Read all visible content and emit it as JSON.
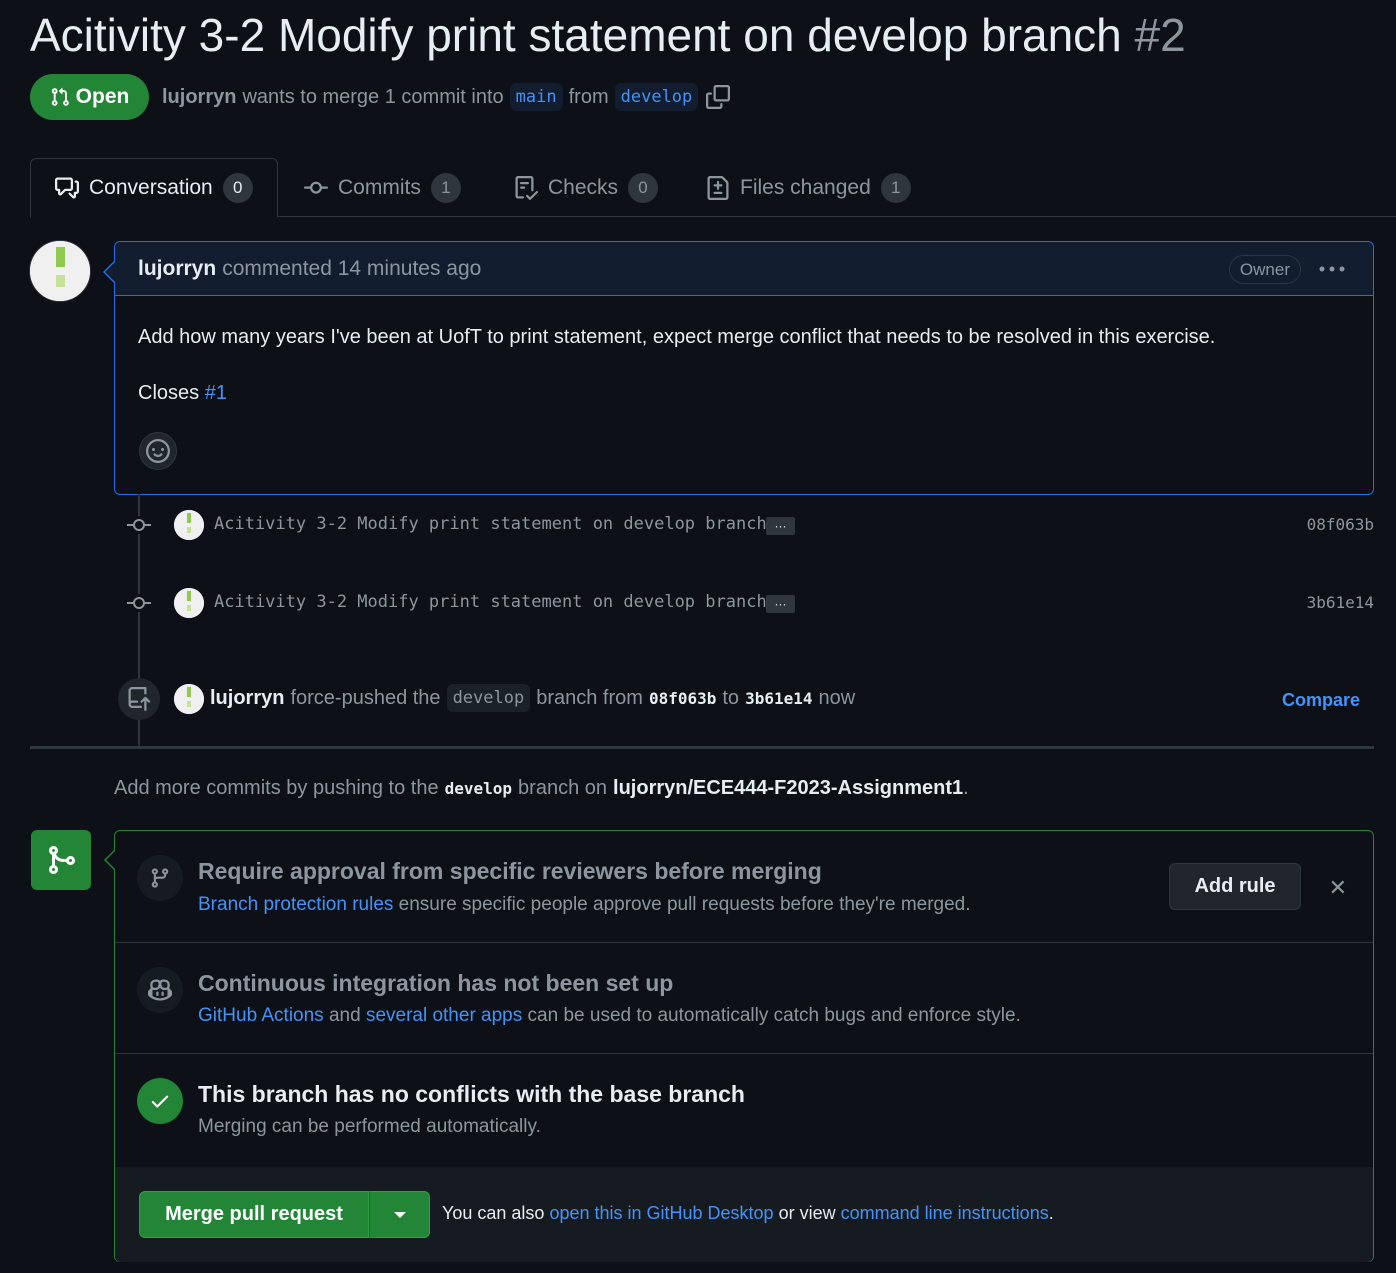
{
  "pr": {
    "title": "Acitivity 3-2 Modify print statement on develop branch",
    "number": "#2",
    "state": "Open",
    "author": "lujorryn",
    "merge_text": "wants to merge 1 commit into",
    "base_branch": "main",
    "from_text": "from",
    "head_branch": "develop"
  },
  "tabs": [
    {
      "label": "Conversation",
      "count": "0",
      "icon": "comment-discussion-icon"
    },
    {
      "label": "Commits",
      "count": "1",
      "icon": "git-commit-icon"
    },
    {
      "label": "Checks",
      "count": "0",
      "icon": "checklist-icon"
    },
    {
      "label": "Files changed",
      "count": "1",
      "icon": "file-diff-icon"
    }
  ],
  "comment": {
    "author": "lujorryn",
    "action": "commented 14 minutes ago",
    "role": "Owner",
    "body": "Add how many years I've been at UofT to print statement, expect merge conflict that needs to be resolved in this exercise.",
    "closes_label": "Closes",
    "closes_ref": "#1"
  },
  "commits": [
    {
      "message": "Acitivity 3-2 Modify print statement on develop branch",
      "sha": "08f063b"
    },
    {
      "message": "Acitivity 3-2 Modify print statement on develop branch",
      "sha": "3b61e14"
    }
  ],
  "force_push": {
    "author": "lujorryn",
    "text1": "force-pushed the",
    "branch": "develop",
    "text2": "branch from",
    "from_sha": "08f063b",
    "text3": "to",
    "to_sha": "3b61e14",
    "time": "now",
    "compare": "Compare"
  },
  "hint": {
    "text1": "Add more commits by pushing to the",
    "branch": "develop",
    "text2": "branch on",
    "repo": "lujorryn/ECE444-F2023-Assignment1",
    "end": "."
  },
  "merge_box": {
    "protection": {
      "title": "Require approval from specific reviewers before merging",
      "link": "Branch protection rules",
      "desc": "ensure specific people approve pull requests before they're merged.",
      "button": "Add rule",
      "dismiss": "✕"
    },
    "ci": {
      "title": "Continuous integration has not been set up",
      "link1": "GitHub Actions",
      "and": "and",
      "link2": "several other apps",
      "desc": "can be used to automatically catch bugs and enforce style."
    },
    "conflicts": {
      "title": "This branch has no conflicts with the base branch",
      "desc": "Merging can be performed automatically."
    },
    "footer": {
      "button": "Merge pull request",
      "text1": "You can also",
      "link1": "open this in GitHub Desktop",
      "text2": "or view",
      "link2": "command line instructions",
      "end": "."
    }
  },
  "colors": {
    "background": "#0d1117",
    "accent_green": "#238636",
    "link_blue": "#4493f8",
    "muted": "#8d96a0"
  }
}
